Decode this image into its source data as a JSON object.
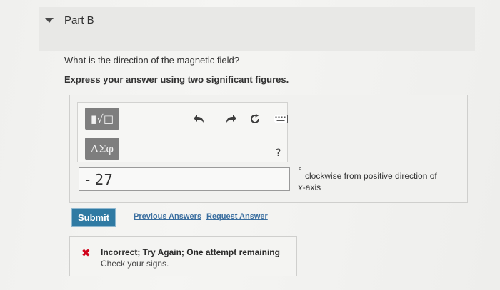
{
  "part": {
    "title": "Part B"
  },
  "question": {
    "prompt": "What is the direction of the magnetic field?",
    "instruction": "Express your answer using two significant figures."
  },
  "toolbar": {
    "templates_label": "▮√□",
    "greek_label": "ΑΣφ",
    "undo_icon": "undo-icon",
    "redo_icon": "redo-icon",
    "reset_icon": "reset-icon",
    "keyboard_icon": "keyboard-icon",
    "help_label": "?"
  },
  "answer": {
    "value": "- 27",
    "unit_degree": "°",
    "unit_line1": "clockwise from positive direction of",
    "unit_var": "x",
    "unit_line2": "-axis"
  },
  "actions": {
    "submit_label": "Submit",
    "previous_answers_label": "Previous Answers",
    "request_answer_label": "Request Answer"
  },
  "feedback": {
    "icon": "x-icon",
    "title": "Incorrect; Try Again; One attempt remaining",
    "detail": "Check your signs.",
    "error_color": "#d0021b"
  },
  "colors": {
    "submit": "#2f7aa3",
    "link": "#3b6fa0"
  }
}
